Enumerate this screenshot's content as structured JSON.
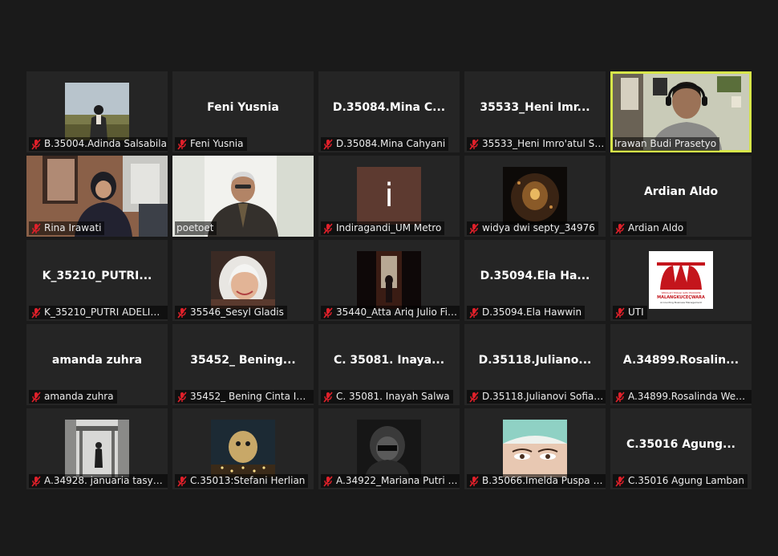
{
  "meeting": {
    "tiles": [
      {
        "label": "B.35004.Adinda Salsabila",
        "muted": true
      },
      {
        "label": "Feni Yusnia",
        "muted": true,
        "big_name": "Feni Yusnia"
      },
      {
        "label": "D.35084.Mina Cahyani",
        "muted": true,
        "big_name": "D.35084.Mina  C..."
      },
      {
        "label": "35533_Heni Imro'atul Sh...",
        "muted": true,
        "big_name": "35533_Heni Imr..."
      },
      {
        "label": "Irawan Budi Prasetyo",
        "muted": false,
        "active_speaker": true
      },
      {
        "label": "Rina Irawati",
        "muted": true
      },
      {
        "label": "poetoet",
        "muted": false
      },
      {
        "label": "Indiragandi_UM Metro",
        "muted": true,
        "avatar_letter": "i"
      },
      {
        "label": "widya dwi septy_34976",
        "muted": true
      },
      {
        "label": "Ardian Aldo",
        "muted": true,
        "big_name": "Ardian Aldo"
      },
      {
        "label": "K_35210_PUTRI ADELIN ...",
        "muted": true,
        "big_name": "K_35210_PUTRI..."
      },
      {
        "label": "35546_Sesyl Gladis",
        "muted": true
      },
      {
        "label": "35440_Atta Ariq Julio Fir...",
        "muted": true
      },
      {
        "label": "D.35094.Ela Hawwin",
        "muted": true,
        "big_name": "D.35094.Ela  Ha..."
      },
      {
        "label": "UTI",
        "muted": true,
        "logo_text": "SEKOLAH TINGGI ILMU EKONOMI",
        "logo_title": "MALANGKUCEÇWARA",
        "logo_sub": "Accounting Business Management"
      },
      {
        "label": "amanda zuhra",
        "muted": true,
        "big_name": "amanda zuhra"
      },
      {
        "label": "35452_ Bening Cinta Ima...",
        "muted": true,
        "big_name": "35452_ Bening..."
      },
      {
        "label": "C. 35081. Inayah Salwa",
        "muted": true,
        "big_name": "C. 35081. Inaya..."
      },
      {
        "label": "D.35118.Julianovi Sofiat...",
        "muted": true,
        "big_name": "D.35118.Juliano..."
      },
      {
        "label": "A.34899.Rosalinda Wea ...",
        "muted": true,
        "big_name": "A.34899.Rosalin..."
      },
      {
        "label": "A.34928. januaria tasya ...",
        "muted": true
      },
      {
        "label": "C.35013:Stefani Herlian",
        "muted": true
      },
      {
        "label": "A.34922_Mariana Putri P...",
        "muted": true
      },
      {
        "label": "B.35066.Imelda Puspa A...",
        "muted": true
      },
      {
        "label": "C.35016 Agung Lamban",
        "muted": true,
        "big_name": "C.35016  Agung..."
      }
    ]
  },
  "colors": {
    "background": "#1a1a1a",
    "tile": "#252525",
    "active_border": "#d7e64a",
    "muted_icon": "#e0202a"
  }
}
